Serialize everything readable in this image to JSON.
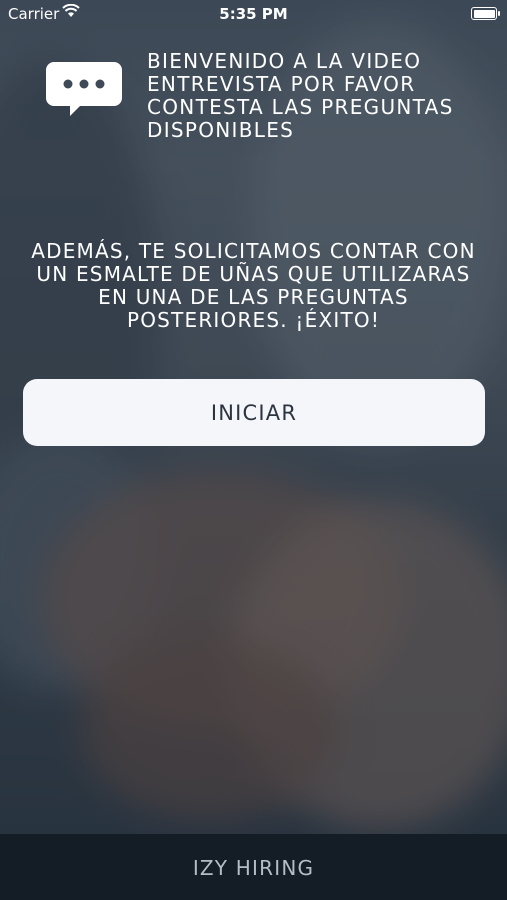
{
  "status_bar": {
    "carrier": "Carrier",
    "time": "5:35 PM"
  },
  "welcome": {
    "icon": "chat-bubble-icon",
    "text": "BIENVENIDO A LA VIDEO ENTREVISTA POR FAVOR CONTESTA LAS PREGUNTAS DISPONIBLES"
  },
  "notice": {
    "text": "ADEMÁS, TE SOLICITAMOS CONTAR CON UN ESMALTE DE UÑAS QUE UTILIZARAS EN UNA DE LAS PREGUNTAS POSTERIORES. ¡ÉXITO!"
  },
  "start_button": {
    "label": "INICIAR"
  },
  "footer": {
    "label": "IZY HIRING"
  },
  "colors": {
    "footer_bg": "#141c26",
    "button_bg": "#f4f6f9",
    "button_text": "#2c3440"
  }
}
